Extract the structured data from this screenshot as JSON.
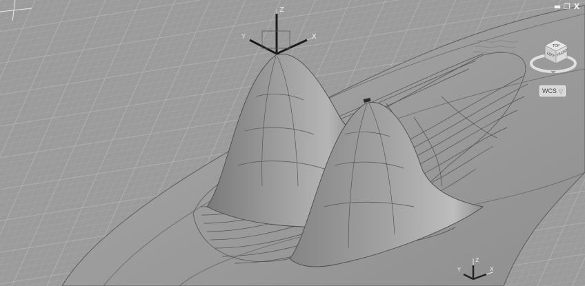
{
  "window_controls": {
    "minimize": "▬",
    "restore": "❐",
    "close": "X"
  },
  "viewcube": {
    "face_top": "TOP",
    "face_left": "LEFT",
    "face_front": "FRONT"
  },
  "wcs": {
    "label": "WCS",
    "menu_arrow": "▽"
  },
  "ucs_gizmo": {
    "x": "X",
    "y": "Y",
    "z": "Z"
  },
  "ucs_icon": {
    "x": "X",
    "y": "Y",
    "z": "Z"
  },
  "colors": {
    "background": "#9b9b9b",
    "grid_line": "#b4b4b4",
    "surface": "#a6a6a6",
    "wire": "#4a4a4a"
  }
}
